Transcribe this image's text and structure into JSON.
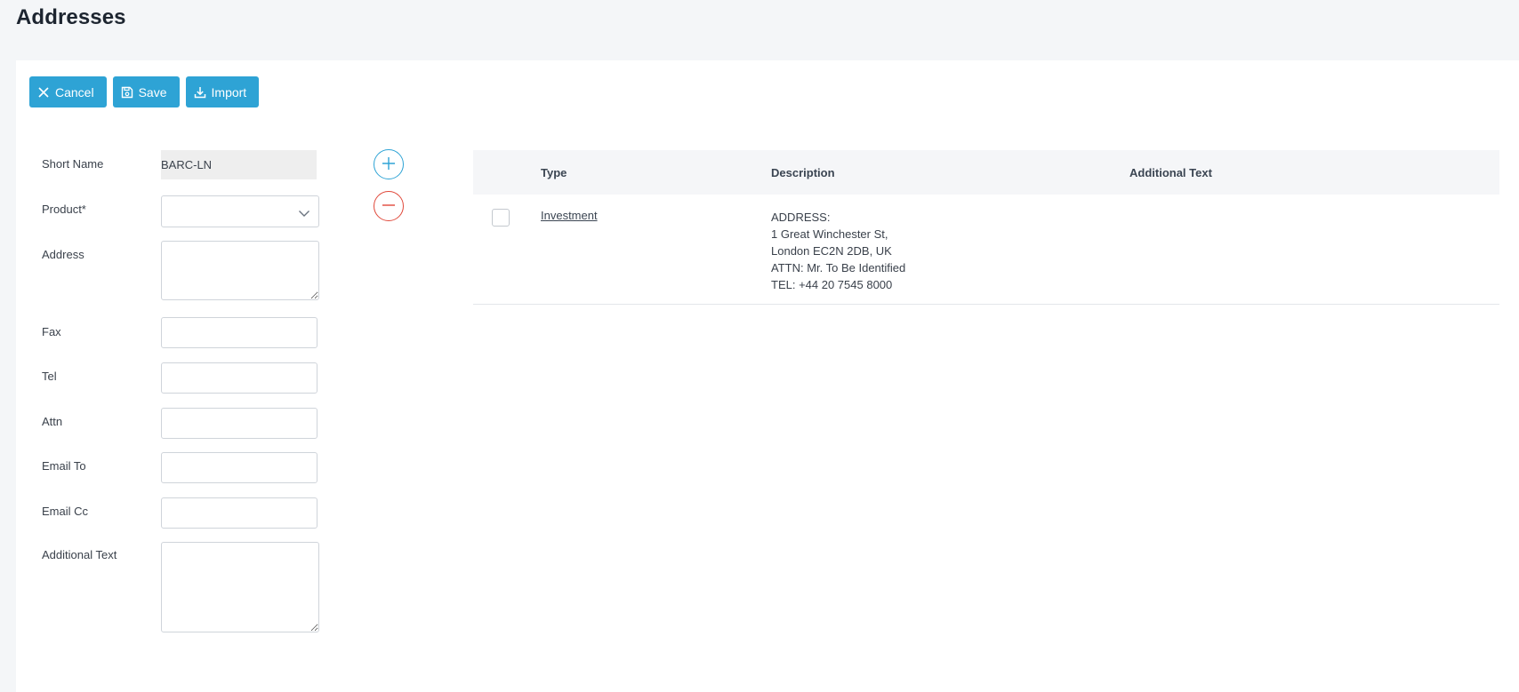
{
  "page": {
    "title": "Addresses"
  },
  "toolbar": {
    "cancel_label": "Cancel",
    "save_label": "Save",
    "import_label": "Import"
  },
  "form": {
    "short_name": {
      "label": "Short Name",
      "value": "BARC-LN"
    },
    "product": {
      "label": "Product*",
      "value": ""
    },
    "address": {
      "label": "Address",
      "value": ""
    },
    "fax": {
      "label": "Fax",
      "value": ""
    },
    "tel": {
      "label": "Tel",
      "value": ""
    },
    "attn": {
      "label": "Attn",
      "value": ""
    },
    "email_to": {
      "label": "Email To",
      "value": ""
    },
    "email_cc": {
      "label": "Email Cc",
      "value": ""
    },
    "additional_text": {
      "label": "Additional Text",
      "value": ""
    }
  },
  "table": {
    "columns": [
      "Type",
      "Description",
      "Additional Text"
    ],
    "rows": [
      {
        "type": "Investment",
        "description": [
          "ADDRESS:",
          "1 Great Winchester St,",
          "London EC2N 2DB, UK",
          "ATTN: Mr. To Be Identified",
          "TEL: +44 20 7545 8000"
        ],
        "additional_text": ""
      }
    ]
  },
  "icons": {
    "cancel": "close-icon",
    "save": "floppy-disk-icon",
    "import": "download-icon",
    "add": "plus-circle-icon",
    "remove": "minus-circle-icon",
    "dropdown": "chevron-down-icon"
  },
  "colors": {
    "primary": "#2ea3d5",
    "danger": "#e0483a",
    "background": "#f4f6f8",
    "panel": "#ffffff",
    "text": "#333a44"
  }
}
